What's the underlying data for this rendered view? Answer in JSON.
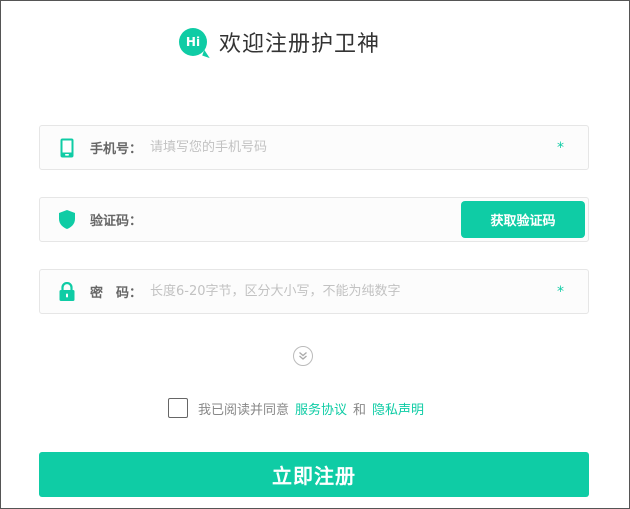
{
  "header": {
    "badge": "Hi",
    "title": "欢迎注册护卫神"
  },
  "form": {
    "phone": {
      "label": "手机号：",
      "placeholder": "请填写您的手机号码",
      "required_mark": "*"
    },
    "code": {
      "label": "验证码：",
      "button_label": "获取验证码"
    },
    "password": {
      "label": "密　码：",
      "placeholder": "长度6-20字节，区分大小写，不能为纯数字",
      "required_mark": "*"
    }
  },
  "agreement": {
    "prefix": "我已阅读并同意",
    "terms_link": "服务协议",
    "and": "和",
    "privacy_link": "隐私声明"
  },
  "submit_label": "立即注册",
  "colors": {
    "accent": "#0fcca5",
    "border": "#e6e6e6",
    "placeholder": "#c2c2c2"
  }
}
